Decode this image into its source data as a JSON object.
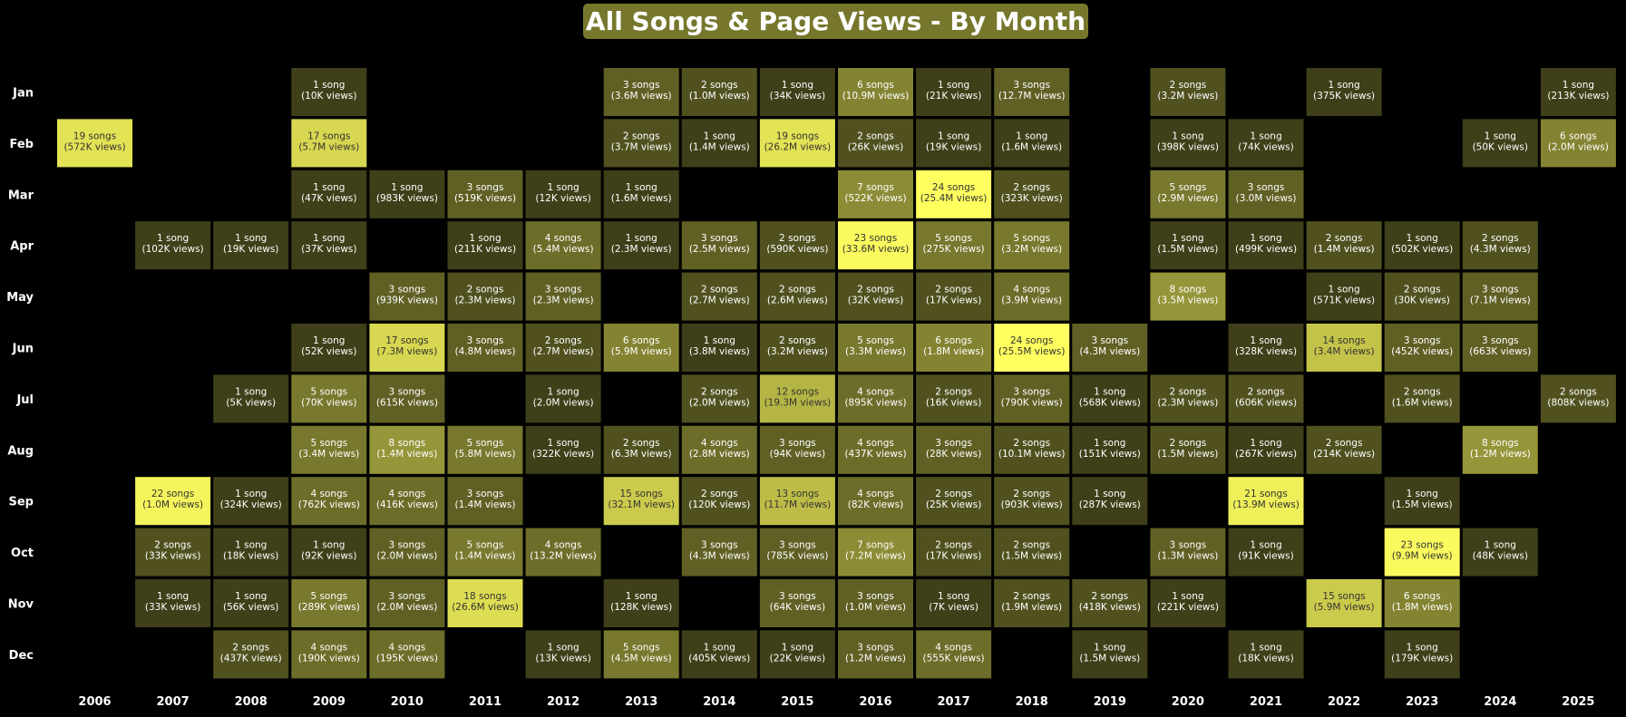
{
  "chart_data": {
    "type": "heatmap",
    "title": "All Songs & Page Views - By Month",
    "years": [
      "2006",
      "2007",
      "2008",
      "2009",
      "2010",
      "2011",
      "2012",
      "2013",
      "2014",
      "2015",
      "2016",
      "2017",
      "2018",
      "2019",
      "2020",
      "2021",
      "2022",
      "2023",
      "2024",
      "2025"
    ],
    "months": [
      "Jan",
      "Feb",
      "Mar",
      "Apr",
      "May",
      "Jun",
      "Jul",
      "Aug",
      "Sep",
      "Oct",
      "Nov",
      "Dec"
    ],
    "song_unit_singular": "song",
    "song_unit_plural": "songs",
    "views_suffix": "views",
    "colorscale": [
      "#16160a",
      "#ffff60"
    ],
    "cells": [
      {
        "year": "2009",
        "month": "Jan",
        "songs": 1,
        "views": "10K"
      },
      {
        "year": "2013",
        "month": "Jan",
        "songs": 3,
        "views": "3.6M"
      },
      {
        "year": "2014",
        "month": "Jan",
        "songs": 2,
        "views": "1.0M"
      },
      {
        "year": "2015",
        "month": "Jan",
        "songs": 1,
        "views": "34K"
      },
      {
        "year": "2016",
        "month": "Jan",
        "songs": 6,
        "views": "10.9M"
      },
      {
        "year": "2017",
        "month": "Jan",
        "songs": 1,
        "views": "21K"
      },
      {
        "year": "2018",
        "month": "Jan",
        "songs": 3,
        "views": "12.7M"
      },
      {
        "year": "2020",
        "month": "Jan",
        "songs": 2,
        "views": "3.2M"
      },
      {
        "year": "2022",
        "month": "Jan",
        "songs": 1,
        "views": "375K"
      },
      {
        "year": "2025",
        "month": "Jan",
        "songs": 1,
        "views": "213K"
      },
      {
        "year": "2006",
        "month": "Feb",
        "songs": 19,
        "views": "572K"
      },
      {
        "year": "2009",
        "month": "Feb",
        "songs": 17,
        "views": "5.7M"
      },
      {
        "year": "2013",
        "month": "Feb",
        "songs": 2,
        "views": "3.7M"
      },
      {
        "year": "2014",
        "month": "Feb",
        "songs": 1,
        "views": "1.4M"
      },
      {
        "year": "2015",
        "month": "Feb",
        "songs": 19,
        "views": "26.2M"
      },
      {
        "year": "2016",
        "month": "Feb",
        "songs": 2,
        "views": "26K"
      },
      {
        "year": "2017",
        "month": "Feb",
        "songs": 1,
        "views": "19K"
      },
      {
        "year": "2018",
        "month": "Feb",
        "songs": 1,
        "views": "1.6M"
      },
      {
        "year": "2020",
        "month": "Feb",
        "songs": 1,
        "views": "398K"
      },
      {
        "year": "2021",
        "month": "Feb",
        "songs": 1,
        "views": "74K"
      },
      {
        "year": "2024",
        "month": "Feb",
        "songs": 1,
        "views": "50K"
      },
      {
        "year": "2025",
        "month": "Feb",
        "songs": 6,
        "views": "2.0M"
      },
      {
        "year": "2009",
        "month": "Mar",
        "songs": 1,
        "views": "47K"
      },
      {
        "year": "2010",
        "month": "Mar",
        "songs": 1,
        "views": "983K"
      },
      {
        "year": "2011",
        "month": "Mar",
        "songs": 3,
        "views": "519K"
      },
      {
        "year": "2012",
        "month": "Mar",
        "songs": 1,
        "views": "12K"
      },
      {
        "year": "2013",
        "month": "Mar",
        "songs": 1,
        "views": "1.6M"
      },
      {
        "year": "2016",
        "month": "Mar",
        "songs": 7,
        "views": "522K"
      },
      {
        "year": "2017",
        "month": "Mar",
        "songs": 24,
        "views": "25.4M"
      },
      {
        "year": "2018",
        "month": "Mar",
        "songs": 2,
        "views": "323K"
      },
      {
        "year": "2020",
        "month": "Mar",
        "songs": 5,
        "views": "2.9M"
      },
      {
        "year": "2021",
        "month": "Mar",
        "songs": 3,
        "views": "3.0M"
      },
      {
        "year": "2007",
        "month": "Apr",
        "songs": 1,
        "views": "102K"
      },
      {
        "year": "2008",
        "month": "Apr",
        "songs": 1,
        "views": "19K"
      },
      {
        "year": "2009",
        "month": "Apr",
        "songs": 1,
        "views": "37K"
      },
      {
        "year": "2011",
        "month": "Apr",
        "songs": 1,
        "views": "211K"
      },
      {
        "year": "2012",
        "month": "Apr",
        "songs": 4,
        "views": "5.4M"
      },
      {
        "year": "2013",
        "month": "Apr",
        "songs": 1,
        "views": "2.3M"
      },
      {
        "year": "2014",
        "month": "Apr",
        "songs": 3,
        "views": "2.5M"
      },
      {
        "year": "2015",
        "month": "Apr",
        "songs": 2,
        "views": "590K"
      },
      {
        "year": "2016",
        "month": "Apr",
        "songs": 23,
        "views": "33.6M"
      },
      {
        "year": "2017",
        "month": "Apr",
        "songs": 5,
        "views": "275K"
      },
      {
        "year": "2018",
        "month": "Apr",
        "songs": 5,
        "views": "3.2M"
      },
      {
        "year": "2020",
        "month": "Apr",
        "songs": 1,
        "views": "1.5M"
      },
      {
        "year": "2021",
        "month": "Apr",
        "songs": 1,
        "views": "499K"
      },
      {
        "year": "2022",
        "month": "Apr",
        "songs": 2,
        "views": "1.4M"
      },
      {
        "year": "2023",
        "month": "Apr",
        "songs": 1,
        "views": "502K"
      },
      {
        "year": "2024",
        "month": "Apr",
        "songs": 2,
        "views": "4.3M"
      },
      {
        "year": "2010",
        "month": "May",
        "songs": 3,
        "views": "939K"
      },
      {
        "year": "2011",
        "month": "May",
        "songs": 2,
        "views": "2.3M"
      },
      {
        "year": "2012",
        "month": "May",
        "songs": 3,
        "views": "2.3M"
      },
      {
        "year": "2014",
        "month": "May",
        "songs": 2,
        "views": "2.7M"
      },
      {
        "year": "2015",
        "month": "May",
        "songs": 2,
        "views": "2.6M"
      },
      {
        "year": "2016",
        "month": "May",
        "songs": 2,
        "views": "32K"
      },
      {
        "year": "2017",
        "month": "May",
        "songs": 2,
        "views": "17K"
      },
      {
        "year": "2018",
        "month": "May",
        "songs": 4,
        "views": "3.9M"
      },
      {
        "year": "2020",
        "month": "May",
        "songs": 8,
        "views": "3.5M"
      },
      {
        "year": "2022",
        "month": "May",
        "songs": 1,
        "views": "571K"
      },
      {
        "year": "2023",
        "month": "May",
        "songs": 2,
        "views": "30K"
      },
      {
        "year": "2024",
        "month": "May",
        "songs": 3,
        "views": "7.1M"
      },
      {
        "year": "2009",
        "month": "Jun",
        "songs": 1,
        "views": "52K"
      },
      {
        "year": "2010",
        "month": "Jun",
        "songs": 17,
        "views": "7.3M"
      },
      {
        "year": "2011",
        "month": "Jun",
        "songs": 3,
        "views": "4.8M"
      },
      {
        "year": "2012",
        "month": "Jun",
        "songs": 2,
        "views": "2.7M"
      },
      {
        "year": "2013",
        "month": "Jun",
        "songs": 6,
        "views": "5.9M"
      },
      {
        "year": "2014",
        "month": "Jun",
        "songs": 1,
        "views": "3.8M"
      },
      {
        "year": "2015",
        "month": "Jun",
        "songs": 2,
        "views": "3.2M"
      },
      {
        "year": "2016",
        "month": "Jun",
        "songs": 5,
        "views": "3.3M"
      },
      {
        "year": "2017",
        "month": "Jun",
        "songs": 6,
        "views": "1.8M"
      },
      {
        "year": "2018",
        "month": "Jun",
        "songs": 24,
        "views": "25.5M"
      },
      {
        "year": "2019",
        "month": "Jun",
        "songs": 3,
        "views": "4.3M"
      },
      {
        "year": "2021",
        "month": "Jun",
        "songs": 1,
        "views": "328K"
      },
      {
        "year": "2022",
        "month": "Jun",
        "songs": 14,
        "views": "3.4M"
      },
      {
        "year": "2023",
        "month": "Jun",
        "songs": 3,
        "views": "452K"
      },
      {
        "year": "2024",
        "month": "Jun",
        "songs": 3,
        "views": "663K"
      },
      {
        "year": "2008",
        "month": "Jul",
        "songs": 1,
        "views": "5K"
      },
      {
        "year": "2009",
        "month": "Jul",
        "songs": 5,
        "views": "70K"
      },
      {
        "year": "2010",
        "month": "Jul",
        "songs": 3,
        "views": "615K"
      },
      {
        "year": "2012",
        "month": "Jul",
        "songs": 1,
        "views": "2.0M"
      },
      {
        "year": "2014",
        "month": "Jul",
        "songs": 2,
        "views": "2.0M"
      },
      {
        "year": "2015",
        "month": "Jul",
        "songs": 12,
        "views": "19.3M"
      },
      {
        "year": "2016",
        "month": "Jul",
        "songs": 4,
        "views": "895K"
      },
      {
        "year": "2017",
        "month": "Jul",
        "songs": 2,
        "views": "16K"
      },
      {
        "year": "2018",
        "month": "Jul",
        "songs": 3,
        "views": "790K"
      },
      {
        "year": "2019",
        "month": "Jul",
        "songs": 1,
        "views": "568K"
      },
      {
        "year": "2020",
        "month": "Jul",
        "songs": 2,
        "views": "2.3M"
      },
      {
        "year": "2021",
        "month": "Jul",
        "songs": 2,
        "views": "606K"
      },
      {
        "year": "2023",
        "month": "Jul",
        "songs": 2,
        "views": "1.6M"
      },
      {
        "year": "2025",
        "month": "Jul",
        "songs": 2,
        "views": "808K"
      },
      {
        "year": "2009",
        "month": "Aug",
        "songs": 5,
        "views": "3.4M"
      },
      {
        "year": "2010",
        "month": "Aug",
        "songs": 8,
        "views": "1.4M"
      },
      {
        "year": "2011",
        "month": "Aug",
        "songs": 5,
        "views": "5.8M"
      },
      {
        "year": "2012",
        "month": "Aug",
        "songs": 1,
        "views": "322K"
      },
      {
        "year": "2013",
        "month": "Aug",
        "songs": 2,
        "views": "6.3M"
      },
      {
        "year": "2014",
        "month": "Aug",
        "songs": 4,
        "views": "2.8M"
      },
      {
        "year": "2015",
        "month": "Aug",
        "songs": 3,
        "views": "94K"
      },
      {
        "year": "2016",
        "month": "Aug",
        "songs": 4,
        "views": "437K"
      },
      {
        "year": "2017",
        "month": "Aug",
        "songs": 3,
        "views": "28K"
      },
      {
        "year": "2018",
        "month": "Aug",
        "songs": 2,
        "views": "10.1M"
      },
      {
        "year": "2019",
        "month": "Aug",
        "songs": 1,
        "views": "151K"
      },
      {
        "year": "2020",
        "month": "Aug",
        "songs": 2,
        "views": "1.5M"
      },
      {
        "year": "2021",
        "month": "Aug",
        "songs": 1,
        "views": "267K"
      },
      {
        "year": "2022",
        "month": "Aug",
        "songs": 2,
        "views": "214K"
      },
      {
        "year": "2024",
        "month": "Aug",
        "songs": 8,
        "views": "1.2M"
      },
      {
        "year": "2007",
        "month": "Sep",
        "songs": 22,
        "views": "1.0M"
      },
      {
        "year": "2008",
        "month": "Sep",
        "songs": 1,
        "views": "324K"
      },
      {
        "year": "2009",
        "month": "Sep",
        "songs": 4,
        "views": "762K"
      },
      {
        "year": "2010",
        "month": "Sep",
        "songs": 4,
        "views": "416K"
      },
      {
        "year": "2011",
        "month": "Sep",
        "songs": 3,
        "views": "1.4M"
      },
      {
        "year": "2013",
        "month": "Sep",
        "songs": 15,
        "views": "32.1M"
      },
      {
        "year": "2014",
        "month": "Sep",
        "songs": 2,
        "views": "120K"
      },
      {
        "year": "2015",
        "month": "Sep",
        "songs": 13,
        "views": "11.7M"
      },
      {
        "year": "2016",
        "month": "Sep",
        "songs": 4,
        "views": "82K"
      },
      {
        "year": "2017",
        "month": "Sep",
        "songs": 2,
        "views": "25K"
      },
      {
        "year": "2018",
        "month": "Sep",
        "songs": 2,
        "views": "903K"
      },
      {
        "year": "2019",
        "month": "Sep",
        "songs": 1,
        "views": "287K"
      },
      {
        "year": "2021",
        "month": "Sep",
        "songs": 21,
        "views": "13.9M"
      },
      {
        "year": "2023",
        "month": "Sep",
        "songs": 1,
        "views": "1.5M"
      },
      {
        "year": "2007",
        "month": "Oct",
        "songs": 2,
        "views": "33K"
      },
      {
        "year": "2008",
        "month": "Oct",
        "songs": 1,
        "views": "18K"
      },
      {
        "year": "2009",
        "month": "Oct",
        "songs": 1,
        "views": "92K"
      },
      {
        "year": "2010",
        "month": "Oct",
        "songs": 3,
        "views": "2.0M"
      },
      {
        "year": "2011",
        "month": "Oct",
        "songs": 5,
        "views": "1.4M"
      },
      {
        "year": "2012",
        "month": "Oct",
        "songs": 4,
        "views": "13.2M"
      },
      {
        "year": "2014",
        "month": "Oct",
        "songs": 3,
        "views": "4.3M"
      },
      {
        "year": "2015",
        "month": "Oct",
        "songs": 3,
        "views": "785K"
      },
      {
        "year": "2016",
        "month": "Oct",
        "songs": 7,
        "views": "7.2M"
      },
      {
        "year": "2017",
        "month": "Oct",
        "songs": 2,
        "views": "17K"
      },
      {
        "year": "2018",
        "month": "Oct",
        "songs": 2,
        "views": "1.5M"
      },
      {
        "year": "2020",
        "month": "Oct",
        "songs": 3,
        "views": "1.3M"
      },
      {
        "year": "2021",
        "month": "Oct",
        "songs": 1,
        "views": "91K"
      },
      {
        "year": "2023",
        "month": "Oct",
        "songs": 23,
        "views": "9.9M"
      },
      {
        "year": "2024",
        "month": "Oct",
        "songs": 1,
        "views": "48K"
      },
      {
        "year": "2007",
        "month": "Nov",
        "songs": 1,
        "views": "33K"
      },
      {
        "year": "2008",
        "month": "Nov",
        "songs": 1,
        "views": "56K"
      },
      {
        "year": "2009",
        "month": "Nov",
        "songs": 5,
        "views": "289K"
      },
      {
        "year": "2010",
        "month": "Nov",
        "songs": 3,
        "views": "2.0M"
      },
      {
        "year": "2011",
        "month": "Nov",
        "songs": 18,
        "views": "26.6M"
      },
      {
        "year": "2013",
        "month": "Nov",
        "songs": 1,
        "views": "128K"
      },
      {
        "year": "2015",
        "month": "Nov",
        "songs": 3,
        "views": "64K"
      },
      {
        "year": "2016",
        "month": "Nov",
        "songs": 3,
        "views": "1.0M"
      },
      {
        "year": "2017",
        "month": "Nov",
        "songs": 1,
        "views": "7K"
      },
      {
        "year": "2018",
        "month": "Nov",
        "songs": 2,
        "views": "1.9M"
      },
      {
        "year": "2019",
        "month": "Nov",
        "songs": 2,
        "views": "418K"
      },
      {
        "year": "2020",
        "month": "Nov",
        "songs": 1,
        "views": "221K"
      },
      {
        "year": "2022",
        "month": "Nov",
        "songs": 15,
        "views": "5.9M"
      },
      {
        "year": "2023",
        "month": "Nov",
        "songs": 6,
        "views": "1.8M"
      },
      {
        "year": "2008",
        "month": "Dec",
        "songs": 2,
        "views": "437K"
      },
      {
        "year": "2009",
        "month": "Dec",
        "songs": 4,
        "views": "190K"
      },
      {
        "year": "2010",
        "month": "Dec",
        "songs": 4,
        "views": "195K"
      },
      {
        "year": "2012",
        "month": "Dec",
        "songs": 1,
        "views": "13K"
      },
      {
        "year": "2013",
        "month": "Dec",
        "songs": 5,
        "views": "4.5M"
      },
      {
        "year": "2014",
        "month": "Dec",
        "songs": 1,
        "views": "405K"
      },
      {
        "year": "2015",
        "month": "Dec",
        "songs": 1,
        "views": "22K"
      },
      {
        "year": "2016",
        "month": "Dec",
        "songs": 3,
        "views": "1.2M"
      },
      {
        "year": "2017",
        "month": "Dec",
        "songs": 4,
        "views": "555K"
      },
      {
        "year": "2019",
        "month": "Dec",
        "songs": 1,
        "views": "1.5M"
      },
      {
        "year": "2021",
        "month": "Dec",
        "songs": 1,
        "views": "18K"
      },
      {
        "year": "2023",
        "month": "Dec",
        "songs": 1,
        "views": "179K"
      }
    ]
  }
}
